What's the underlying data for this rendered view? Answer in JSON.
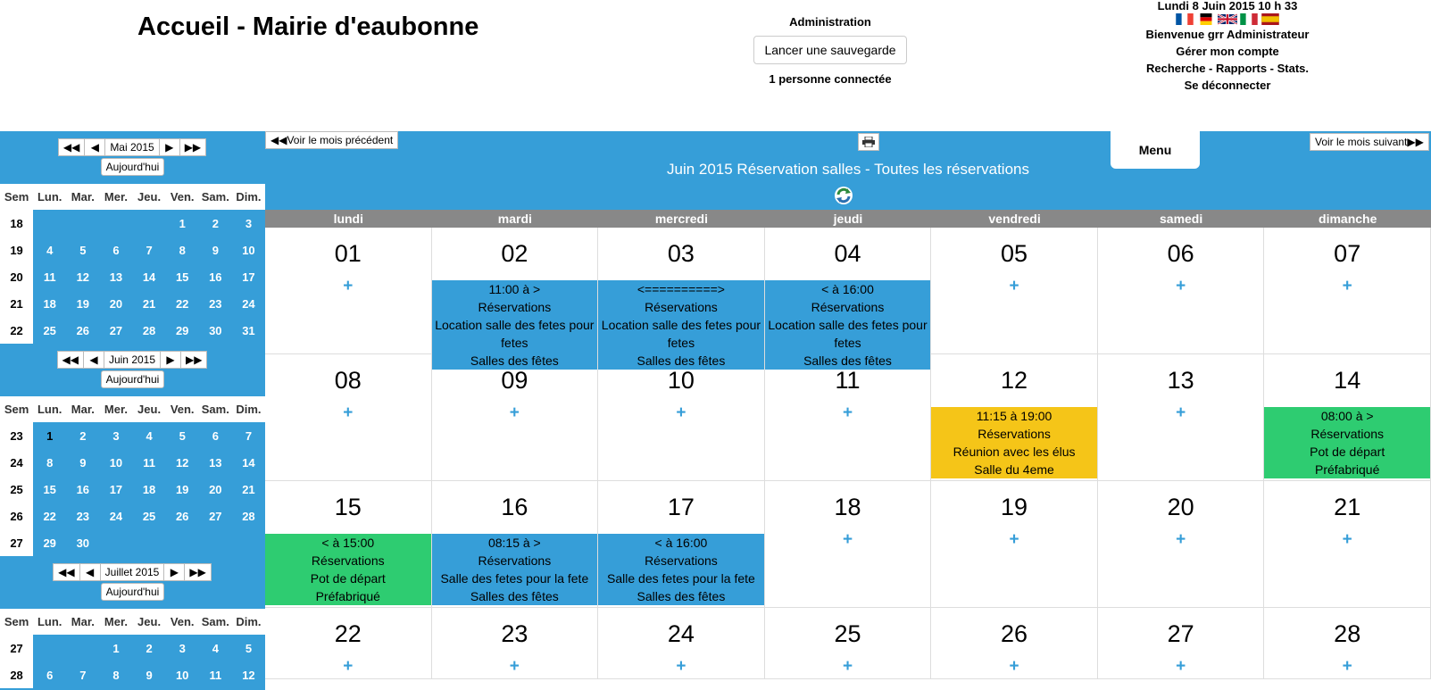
{
  "header": {
    "title": "Accueil - Mairie d'eaubonne",
    "admin_label": "Administration",
    "backup_button": "Lancer une sauvegarde",
    "connected": "1 personne connectée",
    "date": "Lundi 8 Juin 2015  10 h 33",
    "flags": [
      "fr-flag",
      "de-flag",
      "uk-flag",
      "it-flag",
      "es-flag"
    ],
    "welcome": "Bienvenue grr Administrateur",
    "manage_account": "Gérer mon compte",
    "search_links": "Recherche - Rapports - Stats.",
    "logout": "Se déconnecter"
  },
  "sidebar": {
    "today_label": "Aujourd'hui",
    "weekday_headers": [
      "Sem",
      "Lun.",
      "Mar.",
      "Mer.",
      "Jeu.",
      "Ven.",
      "Sam.",
      "Dim."
    ],
    "months": [
      {
        "label": "Mai 2015",
        "rows": [
          [
            "18",
            "",
            "",
            "",
            "",
            "1",
            "2",
            "3"
          ],
          [
            "19",
            "4",
            "5",
            "6",
            "7",
            "8",
            "9",
            "10"
          ],
          [
            "20",
            "11",
            "12",
            "13",
            "14",
            "15",
            "16",
            "17"
          ],
          [
            "21",
            "18",
            "19",
            "20",
            "21",
            "22",
            "23",
            "24"
          ],
          [
            "22",
            "25",
            "26",
            "27",
            "28",
            "29",
            "30",
            "31"
          ]
        ]
      },
      {
        "label": "Juin 2015",
        "rows": [
          [
            "23",
            "1",
            "2",
            "3",
            "4",
            "5",
            "6",
            "7"
          ],
          [
            "24",
            "8",
            "9",
            "10",
            "11",
            "12",
            "13",
            "14"
          ],
          [
            "25",
            "15",
            "16",
            "17",
            "18",
            "19",
            "20",
            "21"
          ],
          [
            "26",
            "22",
            "23",
            "24",
            "25",
            "26",
            "27",
            "28"
          ],
          [
            "27",
            "29",
            "30",
            "",
            "",
            "",
            "",
            ""
          ]
        ]
      },
      {
        "label": "Juillet 2015",
        "rows": [
          [
            "27",
            "",
            "",
            "1",
            "2",
            "3",
            "4",
            "5"
          ],
          [
            "28",
            "6",
            "7",
            "8",
            "9",
            "10",
            "11",
            "12"
          ]
        ]
      }
    ]
  },
  "main": {
    "prev_month": "Voir le mois précédent",
    "next_month": "Voir le mois suivant",
    "menu_tab": "Menu",
    "title": "Juin 2015 Réservation salles - Toutes les réservations",
    "day_headers": [
      "lundi",
      "mardi",
      "mercredi",
      "jeudi",
      "vendredi",
      "samedi",
      "dimanche"
    ],
    "colors": {
      "blue": "#369ed8",
      "yellow": "#f5c518",
      "green": "#2ecc71"
    },
    "weeks": [
      [
        {
          "d": "01"
        },
        {
          "d": "02",
          "evt": {
            "color": "blue",
            "lines": [
              "11:00 à >",
              "Réservations",
              "Location salle des fetes pour fetes",
              "Salles des fêtes"
            ]
          }
        },
        {
          "d": "03",
          "evt": {
            "color": "blue",
            "lines": [
              "<==========>",
              "Réservations",
              "Location salle des fetes pour fetes",
              "Salles des fêtes"
            ]
          }
        },
        {
          "d": "04",
          "evt": {
            "color": "blue",
            "lines": [
              "< à 16:00",
              "Réservations",
              "Location salle des fetes pour fetes",
              "Salles des fêtes"
            ]
          }
        },
        {
          "d": "05"
        },
        {
          "d": "06"
        },
        {
          "d": "07"
        }
      ],
      [
        {
          "d": "08"
        },
        {
          "d": "09"
        },
        {
          "d": "10"
        },
        {
          "d": "11"
        },
        {
          "d": "12",
          "evt": {
            "color": "yellow",
            "lines": [
              "11:15 à 19:00",
              "Réservations",
              "Réunion avec les élus",
              "Salle du 4eme"
            ]
          }
        },
        {
          "d": "13"
        },
        {
          "d": "14",
          "evt": {
            "color": "green",
            "lines": [
              "08:00 à >",
              "Réservations",
              "Pot de départ",
              "Préfabriqué"
            ]
          }
        }
      ],
      [
        {
          "d": "15",
          "evt": {
            "color": "green",
            "lines": [
              "< à 15:00",
              "Réservations",
              "Pot de départ",
              "Préfabriqué"
            ]
          }
        },
        {
          "d": "16",
          "evt": {
            "color": "blue",
            "lines": [
              "08:15 à >",
              "Réservations",
              "Salle des fetes pour la fete",
              "Salles des fêtes"
            ]
          }
        },
        {
          "d": "17",
          "evt": {
            "color": "blue",
            "lines": [
              "< à 16:00",
              "Réservations",
              "Salle des fetes pour la fete",
              "Salles des fêtes"
            ]
          }
        },
        {
          "d": "18"
        },
        {
          "d": "19"
        },
        {
          "d": "20"
        },
        {
          "d": "21"
        }
      ],
      [
        {
          "d": "22"
        },
        {
          "d": "23"
        },
        {
          "d": "24"
        },
        {
          "d": "25"
        },
        {
          "d": "26"
        },
        {
          "d": "27"
        },
        {
          "d": "28"
        }
      ]
    ]
  }
}
